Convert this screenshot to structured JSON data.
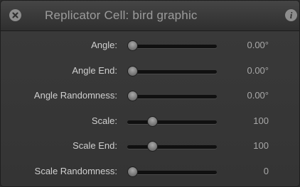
{
  "window": {
    "title": "Replicator Cell: bird graphic",
    "close_icon": "close-icon",
    "info_icon": "info-icon",
    "info_glyph": "i"
  },
  "parameters": [
    {
      "label": "Angle:",
      "value": "0.00°",
      "slider_fraction": 0.0
    },
    {
      "label": "Angle End:",
      "value": "0.00°",
      "slider_fraction": 0.0
    },
    {
      "label": "Angle Randomness:",
      "value": "0.00°",
      "slider_fraction": 0.0
    },
    {
      "label": "Scale:",
      "value": "100",
      "slider_fraction": 0.25
    },
    {
      "label": "Scale End:",
      "value": "100",
      "slider_fraction": 0.25
    },
    {
      "label": "Scale Randomness:",
      "value": "0",
      "slider_fraction": 0.0
    }
  ]
}
